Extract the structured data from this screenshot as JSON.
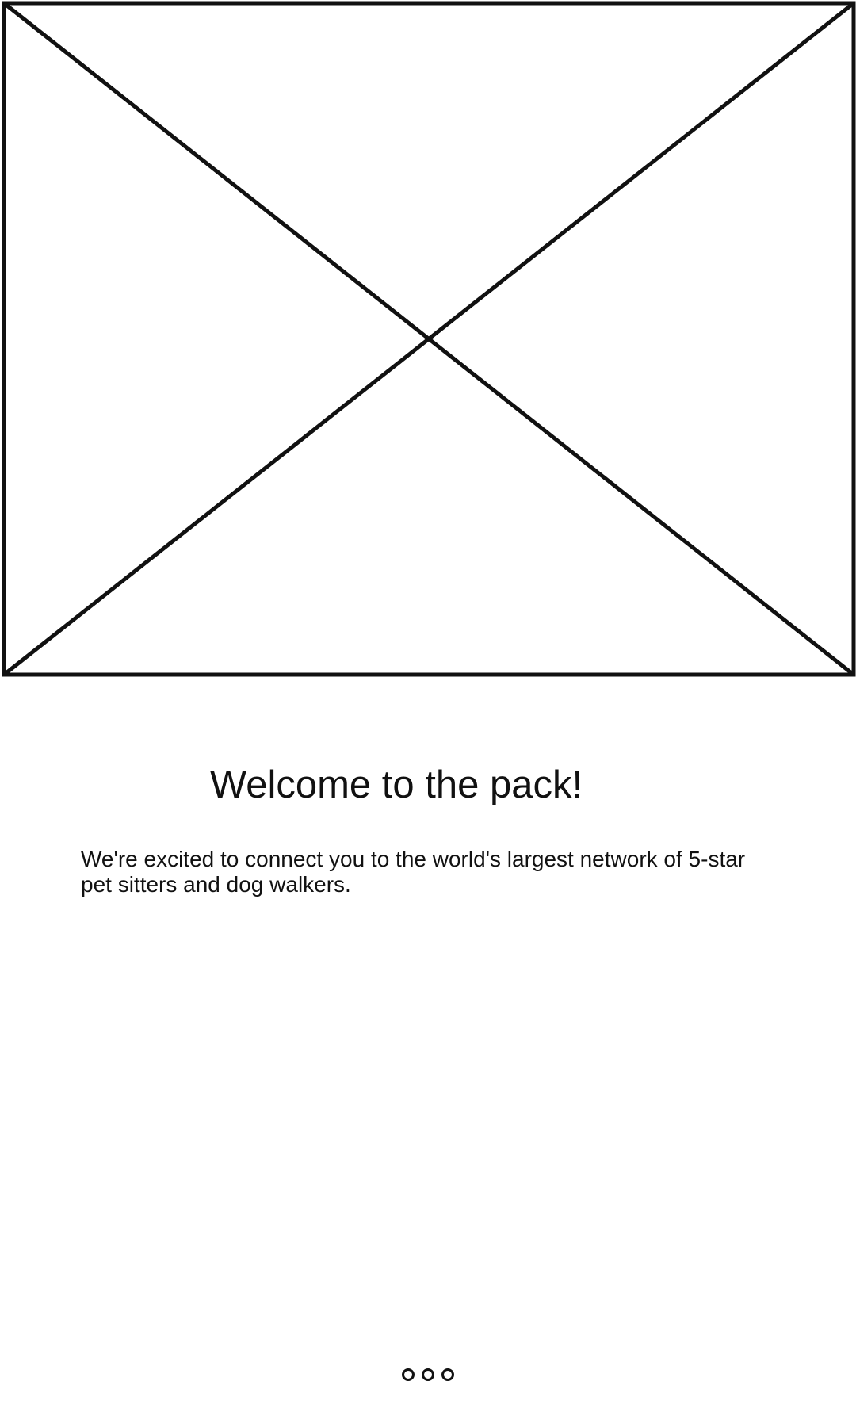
{
  "welcome": {
    "title": "Welcome to the pack!",
    "subtitle": "We're excited to connect you to the world's largest network of 5-star pet sitters and dog walkers."
  },
  "hero_image": {
    "icon": "image-placeholder-icon"
  },
  "pager": {
    "page_count": 3,
    "current_page": 1
  },
  "colors": {
    "stroke": "#111111",
    "background": "#ffffff"
  }
}
